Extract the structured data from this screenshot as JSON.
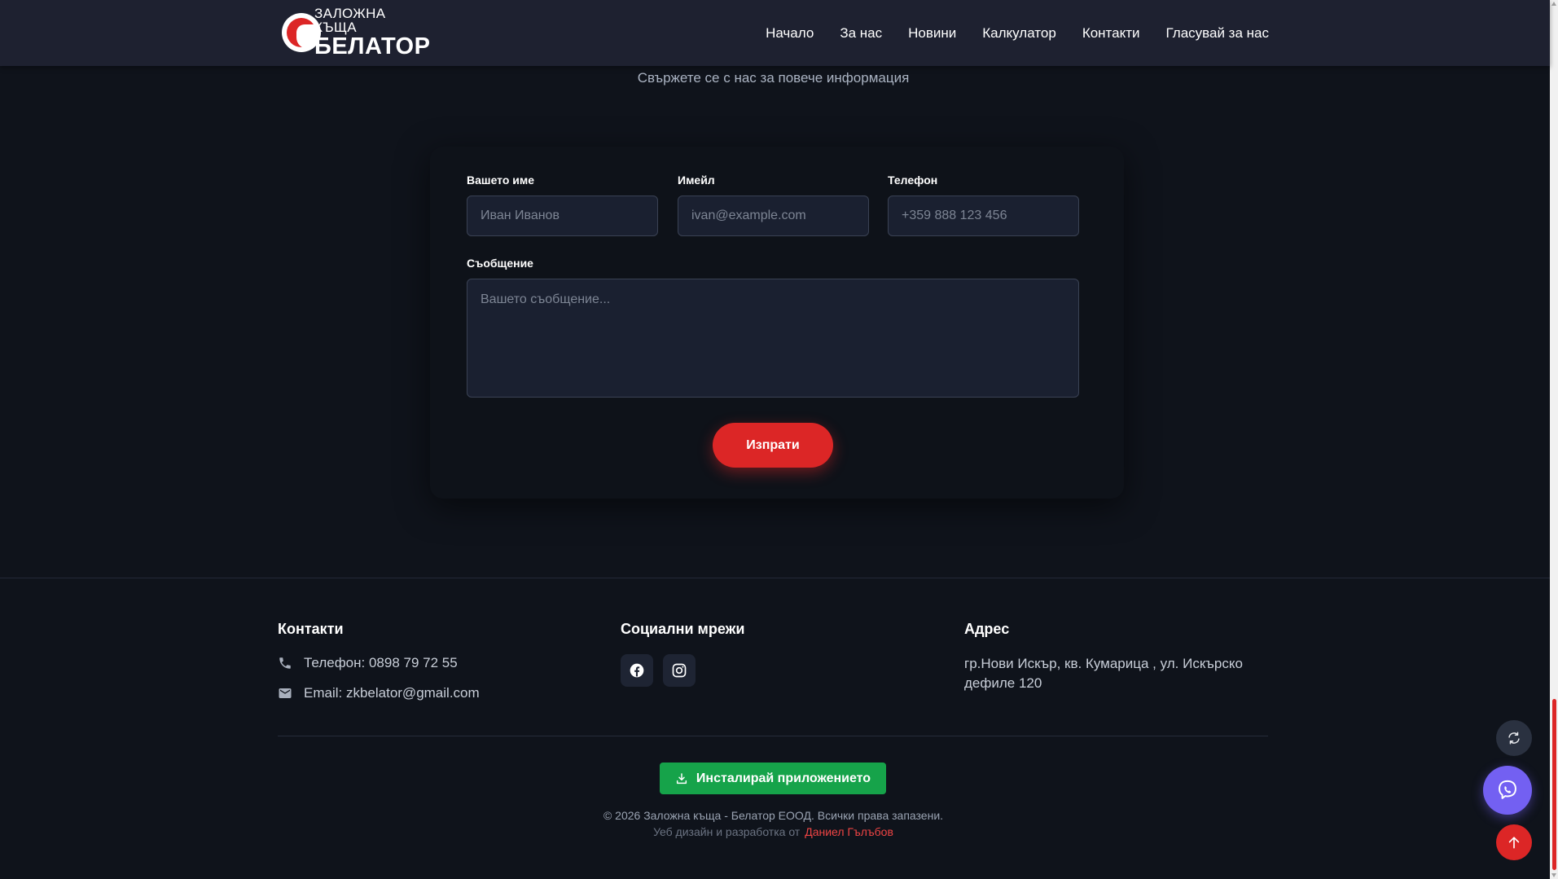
{
  "header": {
    "logo": {
      "top_text": "ЗАЛОЖНА КЪЩА",
      "bottom_text": "БЕЛАТОР"
    },
    "nav": [
      {
        "label": "Начало"
      },
      {
        "label": "За нас"
      },
      {
        "label": "Новини"
      },
      {
        "label": "Калкулатор"
      },
      {
        "label": "Контакти"
      },
      {
        "label": "Гласувай за нас"
      }
    ]
  },
  "contact_section": {
    "subtitle": "Свържете се с нас за повече информация"
  },
  "form": {
    "name": {
      "label": "Вашето име",
      "placeholder": "Иван Иванов",
      "value": ""
    },
    "email": {
      "label": "Имейл",
      "placeholder": "ivan@example.com",
      "value": ""
    },
    "phone": {
      "label": "Телефон",
      "placeholder": "+359 888 123 456",
      "value": ""
    },
    "message": {
      "label": "Съобщение",
      "placeholder": "Вашето съобщение...",
      "value": ""
    },
    "submit_label": "Изпрати"
  },
  "footer": {
    "contacts": {
      "title": "Контакти",
      "phone": "Телефон: 0898 79 72 55",
      "email": "Email: zkbelator@gmail.com"
    },
    "social": {
      "title": "Социални мрежи",
      "icons": [
        "facebook-icon",
        "instagram-icon"
      ]
    },
    "address": {
      "title": "Адрес",
      "text": "гр.Нови Искър, кв. Кумарица , ул. Искърско дефиле 120"
    },
    "install_label": "Инсталирай приложението",
    "copyright": "© 2026 Заложна къща - Белатор ЕООД. Всички права запазени.",
    "credits_prefix": "Уеб дизайн и разработка от",
    "credits_author": "Даниел Гълъбов"
  },
  "colors": {
    "accent": "#dc2626",
    "install_green": "#16a34a",
    "viber_purple": "#7360f2",
    "header_bg": "#1e2130",
    "page_bg": "#0f131b"
  }
}
